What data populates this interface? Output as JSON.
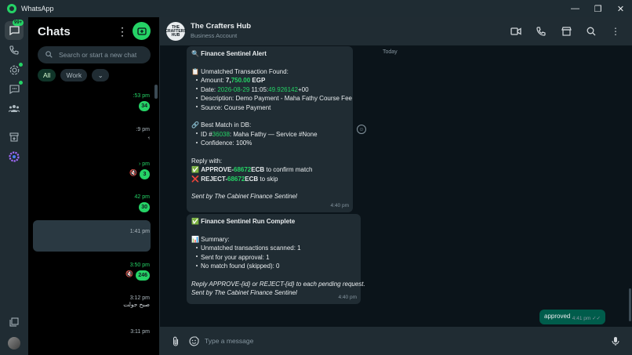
{
  "window": {
    "title": "WhatsApp",
    "controls": [
      "—",
      "❐",
      "✕"
    ]
  },
  "rail": {
    "chats_badge": "99+"
  },
  "chat_list": {
    "title": "Chats",
    "search_placeholder": "Search or start a new chat",
    "filters": [
      "All",
      "Work"
    ],
    "rows": [
      {
        "time": ":53 pm",
        "badge": "34"
      },
      {
        "time": ":9 pm",
        "preview": "ﮨ"
      },
      {
        "time": "› pm",
        "badge": "3"
      },
      {
        "time": "42 pm",
        "badge": "30"
      },
      {
        "time": "1:41 pm"
      },
      {
        "time": "3:50 pm",
        "badge": "246"
      },
      {
        "time": "3:12 pm",
        "preview": "صبح جولت"
      },
      {
        "time": "3:11 pm"
      }
    ]
  },
  "conversation": {
    "name": "The Crafters Hub",
    "subtitle": "Business Account",
    "avatar_text": "THE CRAFTERS HUB",
    "day_label": "Today",
    "composer_placeholder": "Type a message",
    "msg1": {
      "title": "🔍 Finance Sentinel Alert",
      "found": "📋 Unmatched Transaction Found:",
      "amount_label": "Amount: ",
      "amount_pre": "7,",
      "amount_green": "750.00",
      "amount_post": " EGP",
      "date_label": "Date: ",
      "date_green": "2026-08-29",
      "date_mid": " 11:05:",
      "date_green2": "49.926142",
      "date_post": "+00",
      "description": "Description: Demo Payment - Maha Fathy Course Fee",
      "source": "Source: Course Payment",
      "best_match": "🔗 Best Match in DB:",
      "id_label": "ID #",
      "id_green": "36038",
      "id_post": ": Maha Fathy — Service #None",
      "confidence": "Confidence: 100%",
      "reply_with": "Reply with:",
      "approve_icon": "✅",
      "approve_pre": "APPROVE-",
      "approve_green": "68672",
      "approve_post": "ECB",
      "approve_tail": " to confirm match",
      "reject_icon": "❌",
      "reject_pre": "REJECT-",
      "reject_green": "68672",
      "reject_post": "ECB",
      "reject_tail": " to skip",
      "signature": "Sent by The Cabinet Finance Sentinel",
      "time": "4:40 pm"
    },
    "msg2": {
      "title": "✅ Finance Sentinel Run Complete",
      "summary": "📊 Summary:",
      "scanned": "Unmatched transactions scanned: 1",
      "sent": "Sent for your approval: 1",
      "skipped": "No match found (skipped): 0",
      "instructions": "Reply APPROVE-{id} or REJECT-{id} to each pending request.",
      "signature": "Sent by The Cabinet Finance Sentinel",
      "time": "4:40 pm"
    },
    "msg3": {
      "text": "approved",
      "time": "4:41 pm"
    }
  },
  "colors": {
    "accent": "#25d366",
    "panel": "#202c33",
    "background": "#0b141a",
    "outgoing_bubble": "#005c4b"
  }
}
